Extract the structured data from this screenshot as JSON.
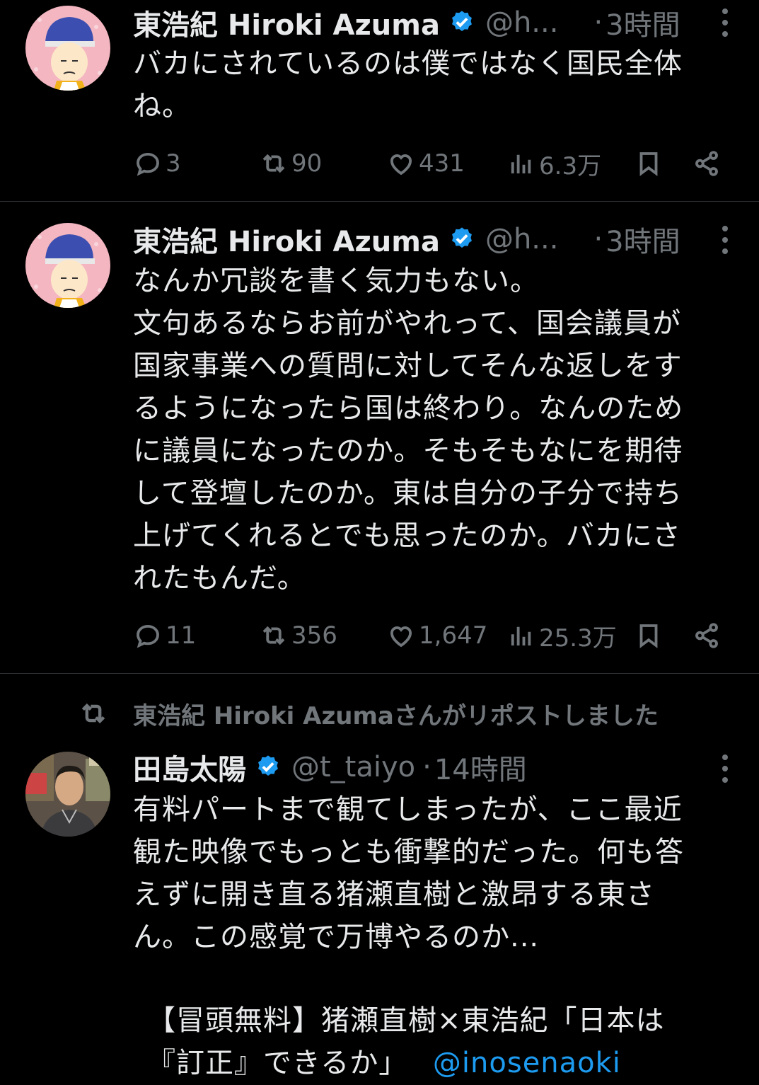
{
  "tweets": [
    {
      "name": "東浩紀 Hiroki Azuma",
      "handle": "@h...",
      "dot": "·",
      "time": "3時間",
      "text": "バカにされているのは僕ではなく国民全体\nね。",
      "replies": "3",
      "reposts": "90",
      "likes": "431",
      "views": "6.3万"
    },
    {
      "name": "東浩紀 Hiroki Azuma",
      "handle": "@h...",
      "dot": "·",
      "time": "3時間",
      "text": "なんか冗談を書く気力もない。\n文句あるならお前がやれって、国会議員が\n国家事業への質問に対してそんな返しをす\nるようになったら国は終わり。なんのため\nに議員になったのか。そもそもなにを期待\nして登壇したのか。東は自分の子分で持ち\n上げてくれるとでも思ったのか。バカにさ\nれたもんだ。",
      "replies": "11",
      "reposts": "356",
      "likes": "1,647",
      "views": "25.3万"
    }
  ],
  "repost": {
    "label": "東浩紀 Hiroki Azumaさんがリポストしました",
    "name": "田島太陽",
    "handle": "@t_taiyo",
    "dot": "·",
    "time": "14時間",
    "text": "有料パートまで観てしまったが、ここ最近\n観た映像でもっとも衝撃的だった。何も答\nえずに開き直る猪瀬直樹と激昂する東さ\nん。この感覚で万博やるのか...",
    "quote_line1": "【冒頭無料】猪瀬直樹×東浩紀「日本は",
    "quote_line2_text": "『訂正』できるか」",
    "quote_mention": "@inosenaoki"
  },
  "colors": {
    "background": "#000000",
    "text": "#e7e9ea",
    "muted": "#71767b",
    "verified": "#1d9bf0",
    "link": "#1d9bf0"
  },
  "icons": [
    "verified-badge-icon",
    "more-icon",
    "reply-icon",
    "repost-icon",
    "like-icon",
    "views-icon",
    "bookmark-icon",
    "share-icon"
  ]
}
